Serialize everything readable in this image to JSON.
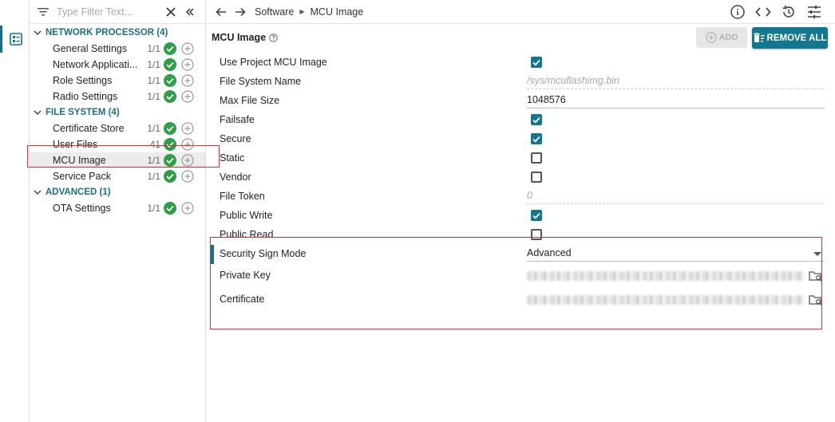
{
  "sidebar": {
    "filter_placeholder": "Type Filter Text...",
    "groups": [
      {
        "title": "NETWORK PROCESSOR (4)",
        "items": [
          {
            "label": "General Settings",
            "count": "1/1"
          },
          {
            "label": "Network Applicati...",
            "count": "1/1"
          },
          {
            "label": "Role Settings",
            "count": "1/1"
          },
          {
            "label": "Radio Settings",
            "count": "1/1"
          }
        ]
      },
      {
        "title": "FILE SYSTEM (4)",
        "items": [
          {
            "label": "Certificate Store",
            "count": "1/1"
          },
          {
            "label": "User Files",
            "count": "41"
          },
          {
            "label": "MCU Image",
            "count": "1/1"
          },
          {
            "label": "Service Pack",
            "count": "1/1"
          }
        ]
      },
      {
        "title": "ADVANCED (1)",
        "items": [
          {
            "label": "OTA Settings",
            "count": "1/1"
          }
        ]
      }
    ]
  },
  "breadcrumb": {
    "parent": "Software",
    "current": "MCU Image"
  },
  "main": {
    "title": "MCU Image",
    "add_label": "ADD",
    "remove_all_label": "REMOVE ALL",
    "fields": {
      "use_project_mcu_image": {
        "label": "Use Project MCU Image",
        "checked": true
      },
      "file_system_name": {
        "label": "File System Name",
        "value": "/sys/mcuflashimg.bin"
      },
      "max_file_size": {
        "label": "Max File Size",
        "value": "1048576"
      },
      "failsafe": {
        "label": "Failsafe",
        "checked": true
      },
      "secure": {
        "label": "Secure",
        "checked": true
      },
      "static": {
        "label": "Static",
        "checked": false
      },
      "vendor": {
        "label": "Vendor",
        "checked": false
      },
      "file_token": {
        "label": "File Token",
        "value": "0"
      },
      "public_write": {
        "label": "Public Write",
        "checked": true
      },
      "public_read": {
        "label": "Public Read",
        "checked": false
      },
      "security_sign_mode": {
        "label": "Security Sign Mode",
        "value": "Advanced"
      },
      "private_key": {
        "label": "Private Key"
      },
      "certificate": {
        "label": "Certificate"
      }
    }
  },
  "colors": {
    "accent": "#12788f",
    "check_green": "#2e9e47",
    "highlight_red": "#d1343a"
  }
}
